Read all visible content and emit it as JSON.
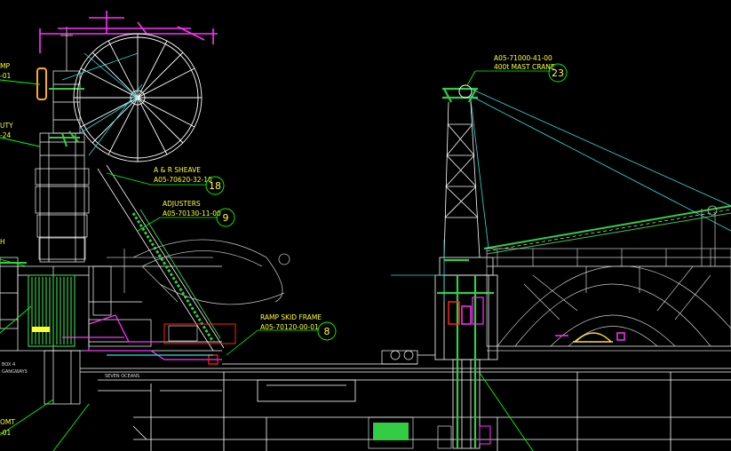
{
  "colors": {
    "background": "#000000",
    "structure": "#ffffff",
    "callout_text": "#ffff33",
    "leader": "#00ff00",
    "rigging": "#33dddd",
    "magenta": "#ff33ff",
    "red": "#ff2020",
    "green_fill": "#33cc44"
  },
  "callouts": {
    "c23": {
      "label": "400t MAST CRANE",
      "ref": "A05-71000-41-00",
      "num": "23"
    },
    "c18": {
      "label": "A & R SHEAVE",
      "ref": "A05-70620-32-10",
      "num": "18"
    },
    "c9": {
      "label": "ADJUSTERS",
      "ref": "A05-70130-11-00",
      "num": "9"
    },
    "c8": {
      "label": "RAMP SKID FRAME",
      "ref": "A05-70120-00-01",
      "num": "8"
    }
  },
  "left_edge_fragments": {
    "f1": "MP",
    "f2": "-01",
    "f3": "UTY",
    "f4": "-24",
    "f5": "H",
    "f6": "OMT",
    "f7": "-01"
  },
  "deck_notes": {
    "n1": "BOX 4",
    "n2": "GANGWAYS",
    "n3": "SEVEN OCEANS"
  }
}
